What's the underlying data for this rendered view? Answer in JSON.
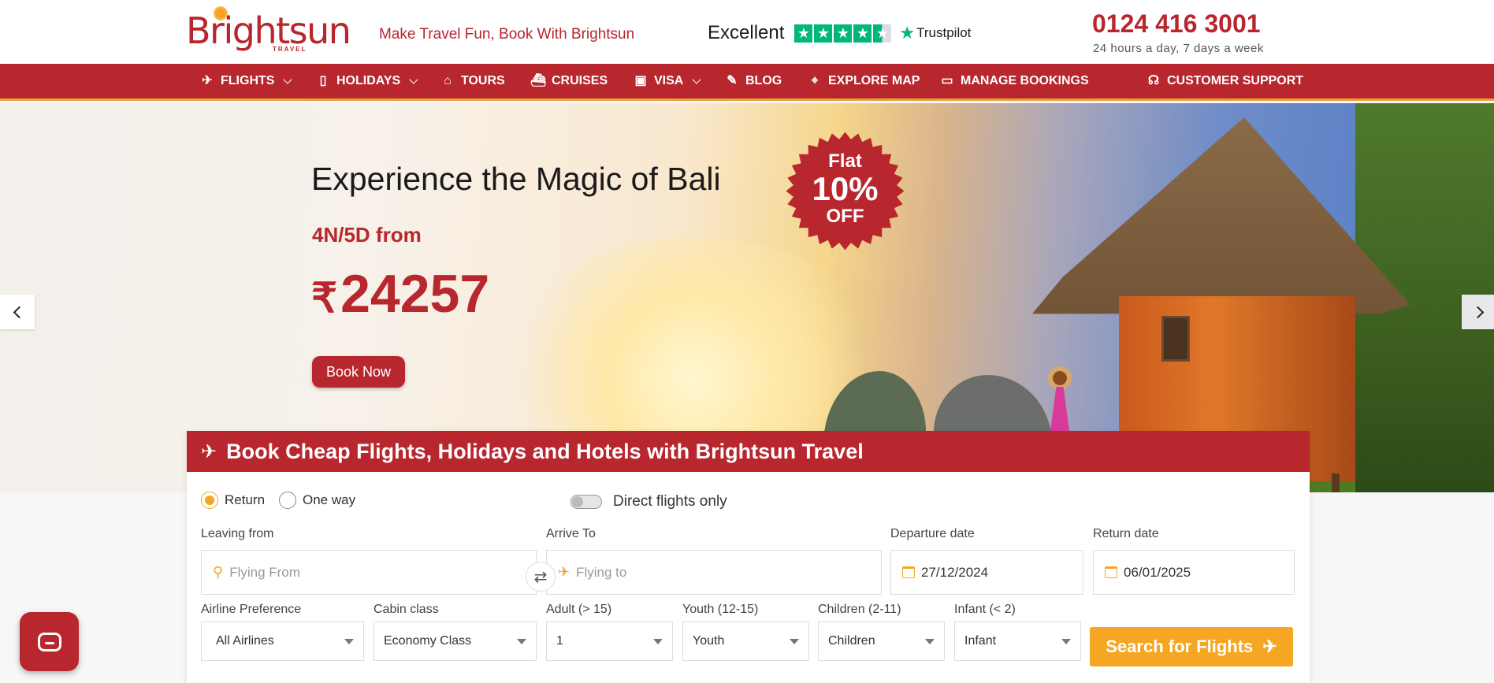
{
  "brand": {
    "name": "Brightsun",
    "sub": "TRAVEL",
    "tagline": "Make Travel Fun, Book With Brightsun",
    "accent": "#b8262e",
    "orange": "#f5a623"
  },
  "trustpilot": {
    "rating_word": "Excellent",
    "stars": 4.5,
    "logo_text": "Trustpilot"
  },
  "contact": {
    "phone": "0124 416 3001",
    "hours": "24 hours a day, 7 days a week"
  },
  "nav": {
    "items": [
      {
        "label": "FLIGHTS",
        "icon": "plane-icon",
        "dropdown": true
      },
      {
        "label": "HOLIDAYS",
        "icon": "luggage-icon",
        "dropdown": true
      },
      {
        "label": "TOURS",
        "icon": "monument-icon",
        "dropdown": false
      },
      {
        "label": "CRUISES",
        "icon": "ship-icon",
        "dropdown": false
      },
      {
        "label": "VISA",
        "icon": "passport-icon",
        "dropdown": true
      },
      {
        "label": "BLOG",
        "icon": "edit-icon",
        "dropdown": false
      },
      {
        "label": "EXPLORE MAP",
        "icon": "map-icon",
        "dropdown": false
      },
      {
        "label": "MANAGE BOOKINGS",
        "icon": "ticket-icon",
        "dropdown": false
      },
      {
        "label": "CUSTOMER SUPPORT",
        "icon": "headset-icon",
        "dropdown": false
      }
    ]
  },
  "hero": {
    "title": "Experience the Magic of Bali",
    "subtitle": "4N/5D from",
    "currency": "₹",
    "price": "24257",
    "cta": "Book Now",
    "badge": {
      "top": "Flat",
      "value": "10%",
      "bottom": "OFF"
    }
  },
  "search": {
    "title": "Book Cheap Flights, Holidays and Hotels with Brightsun Travel",
    "trip_types": [
      "Return",
      "One way"
    ],
    "selected_trip": "Return",
    "direct_label": "Direct flights only",
    "direct_on": false,
    "leaving": {
      "label": "Leaving from",
      "placeholder": "Flying From"
    },
    "arrive": {
      "label": "Arrive To",
      "placeholder": "Flying to"
    },
    "departure": {
      "label": "Departure date",
      "value": "27/12/2024"
    },
    "return": {
      "label": "Return date",
      "value": "06/01/2025"
    },
    "airline": {
      "label": "Airline Preference",
      "value": "All Airlines"
    },
    "cabin": {
      "label": "Cabin class",
      "value": "Economy Class"
    },
    "adult": {
      "label": "Adult (> 15)",
      "value": "1"
    },
    "youth": {
      "label": "Youth (12-15)",
      "value": "Youth"
    },
    "children": {
      "label": "Children (2-11)",
      "value": "Children"
    },
    "infant": {
      "label": "Infant (< 2)",
      "value": "Infant"
    },
    "button": "Search for Flights"
  }
}
